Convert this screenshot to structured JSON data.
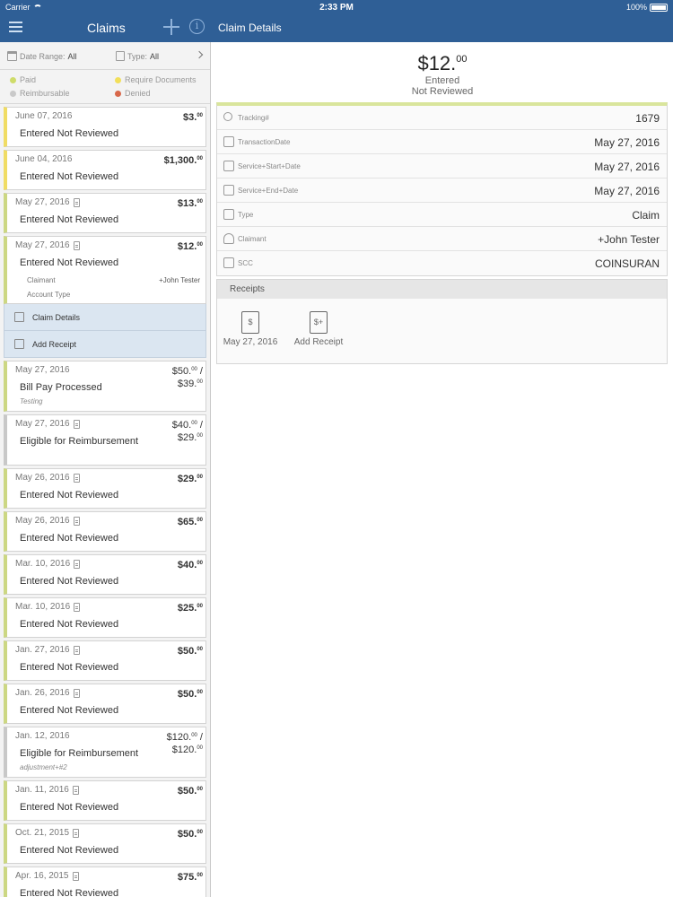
{
  "status_bar": {
    "carrier": "Carrier",
    "time": "2:33 PM",
    "battery": "100%"
  },
  "nav": {
    "title": "Claims",
    "detail_title": "Claim Details"
  },
  "filter": {
    "date_label": "Date Range:",
    "date_value": "All",
    "type_label": "Type:",
    "type_value": "All"
  },
  "legend": [
    {
      "label": "Paid",
      "color": "#cfdc6a"
    },
    {
      "label": "Require Documents",
      "color": "#f2df5a"
    },
    {
      "label": "Reimbursable",
      "color": "#c9c9c9"
    },
    {
      "label": "Denied",
      "color": "#d8684a"
    }
  ],
  "claims": [
    {
      "date": "June 07, 2016",
      "status": "Entered Not Reviewed",
      "amount": "$3.",
      "cents": "00",
      "color": "yellow",
      "receipt": false
    },
    {
      "date": "June 04, 2016",
      "status": "Entered Not Reviewed",
      "amount": "$1,300.",
      "cents": "00",
      "color": "yellow",
      "receipt": false
    },
    {
      "date": "May 27, 2016",
      "status": "Entered Not Reviewed",
      "amount": "$13.",
      "cents": "00",
      "color": "green",
      "receipt": true
    },
    {
      "date": "May 27, 2016",
      "status": "Entered Not Reviewed",
      "amount": "$12.",
      "cents": "00",
      "color": "green",
      "receipt": true,
      "expanded": true,
      "claimant_label": "Claimant",
      "claimant_value": "+John Tester",
      "account_type_label": "Account Type"
    }
  ],
  "actions": [
    {
      "label": "Claim Details"
    },
    {
      "label": "Add Receipt"
    }
  ],
  "claims2": [
    {
      "date": "May 27, 2016",
      "status": "Bill Pay Processed",
      "amount": "$50.",
      "cents": "00",
      "amount2": "$39.",
      "cents2": "00",
      "note": "Testing",
      "color": "green",
      "receipt": false
    },
    {
      "date": "May 27, 2016",
      "status": "Eligible for Reimbursement",
      "amount": "$40.",
      "cents": "00",
      "amount2": "$29.",
      "cents2": "00",
      "color": "gray",
      "receipt": true
    },
    {
      "date": "May 26, 2016",
      "status": "Entered Not Reviewed",
      "amount": "$29.",
      "cents": "00",
      "color": "green",
      "receipt": true
    },
    {
      "date": "May 26, 2016",
      "status": "Entered Not Reviewed",
      "amount": "$65.",
      "cents": "00",
      "color": "green",
      "receipt": true
    },
    {
      "date": "Mar. 10, 2016",
      "status": "Entered Not Reviewed",
      "amount": "$40.",
      "cents": "00",
      "color": "green",
      "receipt": true
    },
    {
      "date": "Mar. 10, 2016",
      "status": "Entered Not Reviewed",
      "amount": "$25.",
      "cents": "00",
      "color": "green",
      "receipt": true
    },
    {
      "date": "Jan. 27, 2016",
      "status": "Entered Not Reviewed",
      "amount": "$50.",
      "cents": "00",
      "color": "green",
      "receipt": true
    },
    {
      "date": "Jan. 26, 2016",
      "status": "Entered Not Reviewed",
      "amount": "$50.",
      "cents": "00",
      "color": "green",
      "receipt": true
    },
    {
      "date": "Jan. 12, 2016",
      "status": "Eligible for Reimbursement",
      "amount": "$120.",
      "cents": "00",
      "amount2": "$120.",
      "cents2": "00",
      "note": "adjustment+#2",
      "color": "gray",
      "receipt": false
    },
    {
      "date": "Jan. 11, 2016",
      "status": "Entered Not Reviewed",
      "amount": "$50.",
      "cents": "00",
      "color": "green",
      "receipt": true
    },
    {
      "date": "Oct. 21, 2015",
      "status": "Entered Not Reviewed",
      "amount": "$50.",
      "cents": "00",
      "color": "green",
      "receipt": true
    },
    {
      "date": "Apr. 16, 2015",
      "status": "Entered Not Reviewed",
      "amount": "$75.",
      "cents": "00",
      "color": "green",
      "receipt": true
    }
  ],
  "detail": {
    "amount": "$12.",
    "cents": "00",
    "status_line1": "Entered",
    "status_line2": "Not Reviewed",
    "rows": [
      {
        "icon": "search-icon",
        "label": "Tracking#",
        "value": "1679"
      },
      {
        "icon": "calendar-icon",
        "label": "TransactionDate",
        "value": "May 27, 2016"
      },
      {
        "icon": "calendar-icon",
        "label": "Service+Start+Date",
        "value": "May 27, 2016"
      },
      {
        "icon": "calendar-icon",
        "label": "Service+End+Date",
        "value": "May 27, 2016"
      },
      {
        "icon": "tag-icon",
        "label": "Type",
        "value": "Claim"
      },
      {
        "icon": "person-icon",
        "label": "Claimant",
        "value": "+John Tester"
      },
      {
        "icon": "receipt-icon",
        "label": "SCC",
        "value": "COINSURAN"
      }
    ],
    "receipts_title": "Receipts",
    "receipt_tiles": [
      {
        "label": "May 27, 2016"
      },
      {
        "label": "Add Receipt"
      }
    ]
  }
}
